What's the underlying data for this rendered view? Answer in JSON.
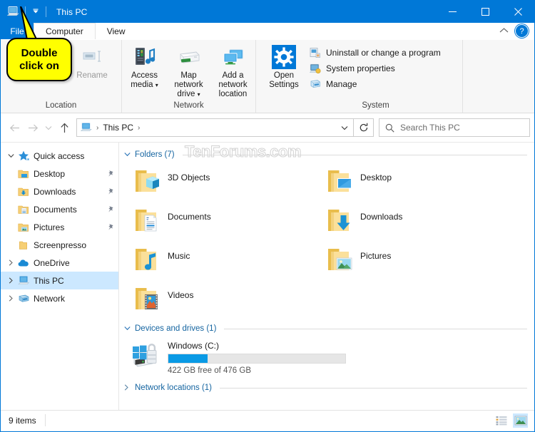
{
  "window": {
    "title": "This PC",
    "quick_access_icons": [
      "this-pc-icon",
      "customize-qat-chevron"
    ],
    "controls": {
      "minimize": "–",
      "maximize": "☐",
      "close": "✕"
    }
  },
  "ribbon": {
    "tabs": [
      {
        "label": "File",
        "active": false,
        "id": "file"
      },
      {
        "label": "Computer",
        "active": true,
        "id": "computer"
      },
      {
        "label": "View",
        "active": false,
        "id": "view"
      }
    ],
    "collapse_label": "∧",
    "help_label": "?",
    "groups": [
      {
        "label": "Location",
        "buttons": [
          {
            "label": "Rename",
            "icon": "rename-icon",
            "disabled": true,
            "has_caret": false
          }
        ]
      },
      {
        "label": "Network",
        "buttons": [
          {
            "label": "Access media",
            "icon": "access-media-icon",
            "disabled": false,
            "has_caret": true
          },
          {
            "label": "Map network drive",
            "icon": "map-network-drive-icon",
            "disabled": false,
            "has_caret": true
          },
          {
            "label": "Add a network location",
            "icon": "add-network-location-icon",
            "disabled": false,
            "has_caret": false
          }
        ]
      },
      {
        "label": "System",
        "buttons": [
          {
            "label": "Open Settings",
            "icon": "settings-gear-icon",
            "disabled": false,
            "has_caret": false
          }
        ],
        "commands": [
          {
            "label": "Uninstall or change a program",
            "icon": "uninstall-program-icon"
          },
          {
            "label": "System properties",
            "icon": "system-properties-icon"
          },
          {
            "label": "Manage",
            "icon": "manage-icon"
          }
        ]
      }
    ]
  },
  "address_bar": {
    "back_icon": "back-arrow-icon",
    "forward_icon": "forward-arrow-icon",
    "recent_icon": "recent-locations-chevron-icon",
    "up_icon": "up-arrow-icon",
    "crumbs": [
      "This PC"
    ],
    "dropdown_icon": "address-dropdown-chevron",
    "refresh_icon": "refresh-icon",
    "search": {
      "placeholder": "Search This PC",
      "icon": "search-icon"
    }
  },
  "sidebar": {
    "items": [
      {
        "label": "Quick access",
        "icon": "star-icon",
        "chevron": "expanded",
        "indent": false,
        "pinned": false,
        "selected": false
      },
      {
        "label": "Desktop",
        "icon": "desktop-folder-icon",
        "chevron": "none",
        "indent": true,
        "pinned": true,
        "selected": false
      },
      {
        "label": "Downloads",
        "icon": "downloads-folder-icon",
        "chevron": "none",
        "indent": true,
        "pinned": true,
        "selected": false
      },
      {
        "label": "Documents",
        "icon": "documents-folder-icon",
        "chevron": "none",
        "indent": true,
        "pinned": true,
        "selected": false
      },
      {
        "label": "Pictures",
        "icon": "pictures-folder-icon",
        "chevron": "none",
        "indent": true,
        "pinned": true,
        "selected": false
      },
      {
        "label": "Screenpresso",
        "icon": "plain-folder-icon",
        "chevron": "none",
        "indent": true,
        "pinned": false,
        "selected": false
      },
      {
        "label": "OneDrive",
        "icon": "onedrive-cloud-icon",
        "chevron": "collapsed",
        "indent": false,
        "pinned": false,
        "selected": false
      },
      {
        "label": "This PC",
        "icon": "this-pc-icon",
        "chevron": "collapsed",
        "indent": false,
        "pinned": false,
        "selected": true
      },
      {
        "label": "Network",
        "icon": "network-icon",
        "chevron": "collapsed",
        "indent": false,
        "pinned": false,
        "selected": false
      }
    ]
  },
  "content": {
    "watermark": "TenForums.com",
    "groups": [
      {
        "id": "folders",
        "label": "Folders (7)",
        "expanded": true
      },
      {
        "id": "devices",
        "label": "Devices and drives (1)",
        "expanded": true
      },
      {
        "id": "network",
        "label": "Network locations (1)",
        "expanded": false
      }
    ],
    "folders": [
      {
        "label": "3D Objects",
        "icon": "3d-objects-folder-icon"
      },
      {
        "label": "Desktop",
        "icon": "desktop-folder-icon"
      },
      {
        "label": "Documents",
        "icon": "documents-folder-icon"
      },
      {
        "label": "Downloads",
        "icon": "downloads-folder-icon"
      },
      {
        "label": "Music",
        "icon": "music-folder-icon"
      },
      {
        "label": "Pictures",
        "icon": "pictures-folder-icon"
      },
      {
        "label": "Videos",
        "icon": "videos-folder-icon"
      }
    ],
    "drives": [
      {
        "label": "Windows (C:)",
        "icon": "windows-drive-bitlocker-icon",
        "capacity_text": "422 GB free of 476 GB",
        "used_percent": 11
      }
    ]
  },
  "status_bar": {
    "item_count": "9 items",
    "views": [
      {
        "id": "details-view",
        "icon": "details-view-icon",
        "active": false
      },
      {
        "id": "large-icons-view",
        "icon": "large-icons-view-icon",
        "active": true
      }
    ]
  },
  "callout": {
    "line1": "Double",
    "line2": "click on",
    "background": "#ffff00",
    "border": "#000000"
  },
  "colors": {
    "accent": "#0078d7",
    "selection": "#cce8ff",
    "link": "#1464a0",
    "bar_fill": "#0a9ae5"
  }
}
